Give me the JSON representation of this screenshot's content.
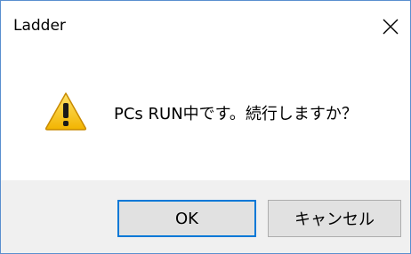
{
  "window": {
    "title": "Ladder",
    "close_glyph": "✕"
  },
  "dialog": {
    "icon": "warning-icon",
    "message": "PCs RUN中です。続行しますか？"
  },
  "buttons": {
    "ok_label": "OK",
    "cancel_label": "キャンセル"
  },
  "colors": {
    "border": "#5a8fcf",
    "footer_bg": "#f0f0f0",
    "button_bg": "#e1e1e1",
    "default_button_border": "#0078d7",
    "warning_yellow": "#f5c518"
  }
}
